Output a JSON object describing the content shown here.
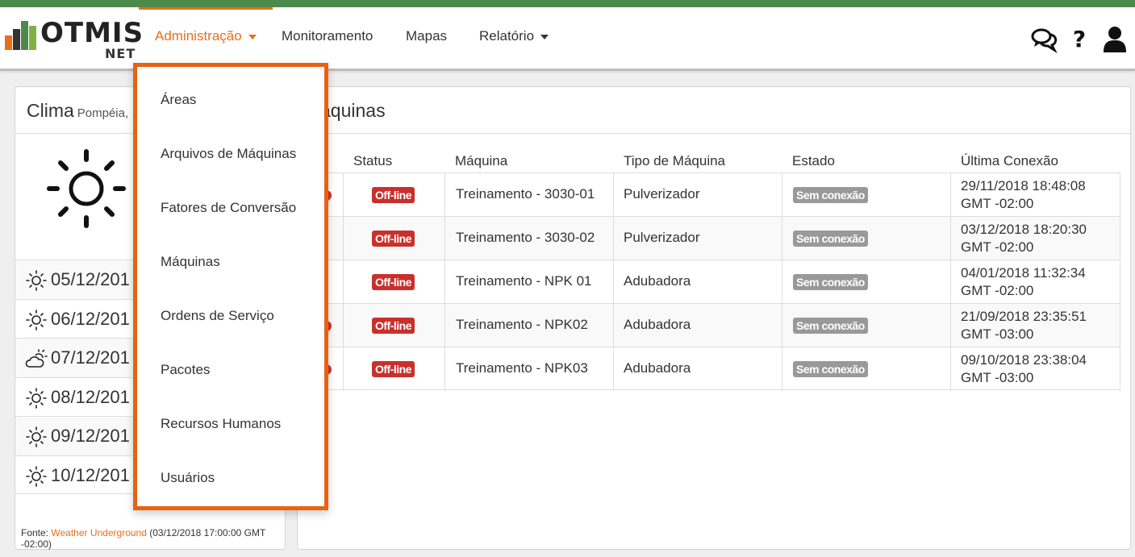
{
  "brand": {
    "name": "OTMIS",
    "sub": "NET"
  },
  "nav": {
    "items": [
      {
        "label": "Administração"
      },
      {
        "label": "Monitoramento"
      },
      {
        "label": "Mapas"
      },
      {
        "label": "Relatório"
      }
    ]
  },
  "icons": {
    "chat": "chat-bubbles-icon",
    "help": "question-icon",
    "user": "user-icon"
  },
  "colors": {
    "accent": "#e86f1a",
    "brand_green": "#4c8a4c",
    "offline": "#c9302c",
    "sem_conexao": "#999999"
  },
  "weather": {
    "title": "Clima",
    "city": "Pompéia,",
    "forecast": [
      {
        "date": "05/12/201",
        "icon": "sun-icon"
      },
      {
        "date": "06/12/201",
        "icon": "sun-icon"
      },
      {
        "date": "07/12/201",
        "icon": "cloud-sun-icon"
      },
      {
        "date": "08/12/201",
        "icon": "sun-icon"
      },
      {
        "date": "09/12/201",
        "icon": "sun-icon"
      },
      {
        "date": "10/12/201",
        "icon": "sun-icon"
      }
    ],
    "source_prefix": "Fonte:",
    "source_link": "Weather Underground",
    "source_suffix": "(03/12/2018 17:00:00 GMT -02:00)"
  },
  "machines": {
    "title": "áquinas",
    "headers": [
      "Status",
      "Máquina",
      "Tipo de Máquina",
      "Estado",
      "Última Conexão"
    ],
    "rows": [
      {
        "dot": true,
        "status": "Off-line",
        "machine": "Treinamento - 3030-01",
        "type": "Pulverizador",
        "state": "Sem conexão",
        "last_date": "29/11/2018 18:48:08",
        "last_tz": "GMT -02:00"
      },
      {
        "dot": false,
        "status": "Off-line",
        "machine": "Treinamento - 3030-02",
        "type": "Pulverizador",
        "state": "Sem conexão",
        "last_date": "03/12/2018 18:20:30",
        "last_tz": "GMT -02:00"
      },
      {
        "dot": false,
        "status": "Off-line",
        "machine": "Treinamento - NPK 01",
        "type": "Adubadora",
        "state": "Sem conexão",
        "last_date": "04/01/2018 11:32:34",
        "last_tz": "GMT -02:00"
      },
      {
        "dot": true,
        "status": "Off-line",
        "machine": "Treinamento - NPK02",
        "type": "Adubadora",
        "state": "Sem conexão",
        "last_date": "21/09/2018 23:35:51",
        "last_tz": "GMT -03:00"
      },
      {
        "dot": true,
        "status": "Off-line",
        "machine": "Treinamento - NPK03",
        "type": "Adubadora",
        "state": "Sem conexão",
        "last_date": "09/10/2018 23:38:04",
        "last_tz": "GMT -03:00"
      }
    ]
  },
  "admin_menu": {
    "items": [
      {
        "label": "Áreas"
      },
      {
        "label": "Arquivos de Máquinas"
      },
      {
        "label": "Fatores de Conversão"
      },
      {
        "label": "Máquinas"
      },
      {
        "label": "Ordens de Serviço"
      },
      {
        "label": "Pacotes"
      },
      {
        "label": "Recursos Humanos"
      },
      {
        "label": "Usuários"
      }
    ]
  }
}
